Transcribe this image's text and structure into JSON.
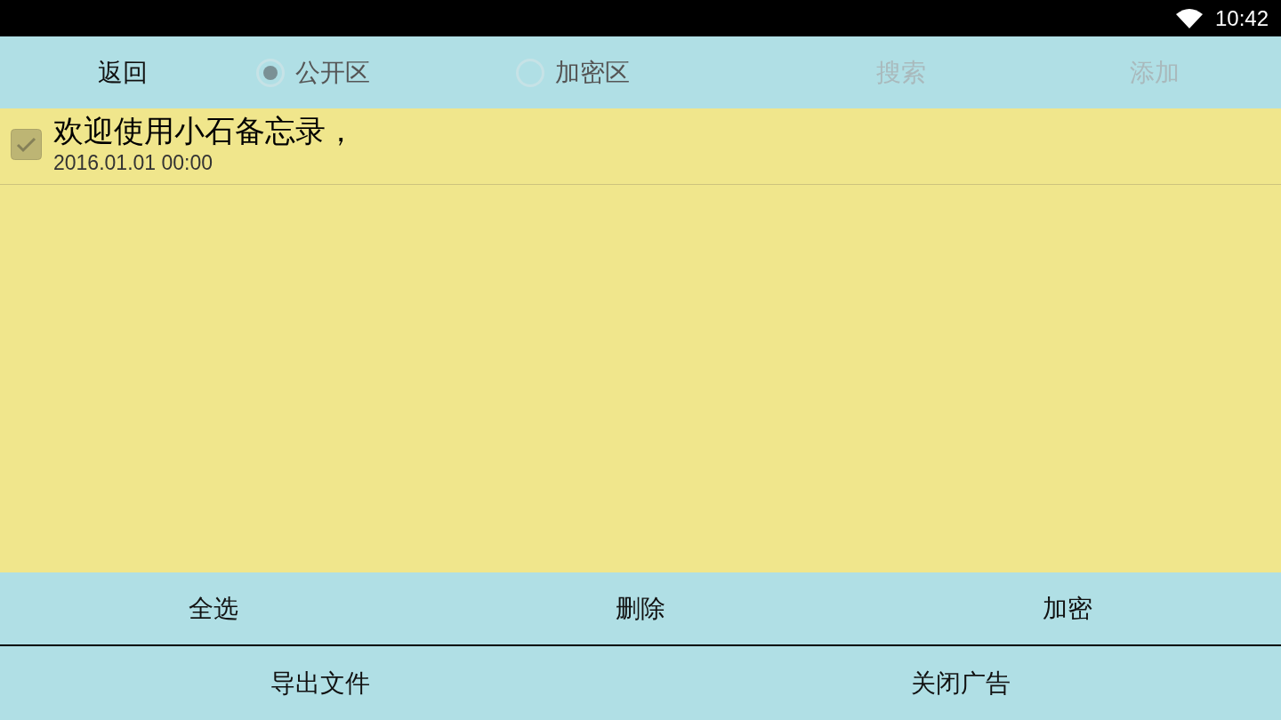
{
  "status_bar": {
    "time": "10:42"
  },
  "toolbar": {
    "back": {
      "label": "返回",
      "disabled": false
    },
    "zones": [
      {
        "label": "公开区",
        "selected": true
      },
      {
        "label": "加密区",
        "selected": false
      }
    ],
    "actions": [
      {
        "label": "搜索",
        "disabled": true
      },
      {
        "label": "添加",
        "disabled": true
      }
    ]
  },
  "notes": [
    {
      "title": "欢迎使用小石备忘录，",
      "date": "2016.01.01 00:00",
      "checked": true
    }
  ],
  "bottom_bar": {
    "rows": [
      {
        "buttons": [
          "全选",
          "删除",
          "加密"
        ]
      },
      {
        "buttons": [
          "导出文件",
          "关闭广告"
        ]
      }
    ]
  }
}
